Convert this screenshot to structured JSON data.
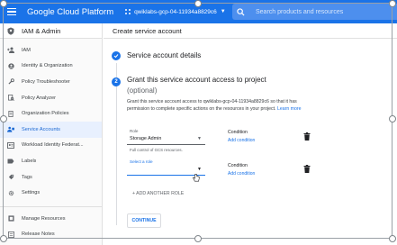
{
  "topbar": {
    "title": "Google Cloud Platform",
    "project": "qwiklabs-gcp-04-11934a8829c6",
    "search_placeholder": "Search products and resources"
  },
  "sidebar": {
    "header": "IAM & Admin",
    "items": [
      {
        "label": "IAM",
        "icon": "person-add-icon"
      },
      {
        "label": "Identity & Organization",
        "icon": "account-circle-icon"
      },
      {
        "label": "Policy Troubleshooter",
        "icon": "wrench-icon"
      },
      {
        "label": "Policy Analyzer",
        "icon": "policy-analyzer-icon"
      },
      {
        "label": "Organization Policies",
        "icon": "document-icon"
      },
      {
        "label": "Service Accounts",
        "icon": "service-account-icon",
        "active": true
      },
      {
        "label": "Workload Identity Federat...",
        "icon": "workload-identity-icon"
      },
      {
        "label": "Labels",
        "icon": "label-icon"
      },
      {
        "label": "Tags",
        "icon": "tag-icon"
      },
      {
        "label": "Settings",
        "icon": "gear-icon"
      }
    ],
    "bottom_items": [
      {
        "label": "Manage Resources",
        "icon": "manage-resources-icon"
      },
      {
        "label": "Release Notes",
        "icon": "release-notes-icon"
      }
    ]
  },
  "page": {
    "title": "Create service account",
    "step1_title": "Service account details",
    "step2_number": "2",
    "step2_title": "Grant this service account access to project",
    "step2_optional": "(optional)",
    "step2_desc_main": "Grant this service account access to qwiklabs-gcp-04-11934a8829c6 so that it has permission to complete specific actions on the resources in your project.",
    "step2_desc_link": "Learn more",
    "role1": {
      "label": "Role",
      "value": "Storage Admin",
      "hint": "Full control of GCS resources.",
      "condition_label": "Condition",
      "condition_link": "Add condition"
    },
    "role2": {
      "label": "Select a role",
      "value": "",
      "condition_label": "Condition",
      "condition_link": "Add condition"
    },
    "add_role": "+ ADD ANOTHER ROLE",
    "continue": "CONTINUE"
  },
  "colors": {
    "brand_blue": "#1a73e8",
    "active_bg": "#e8f0fe"
  }
}
